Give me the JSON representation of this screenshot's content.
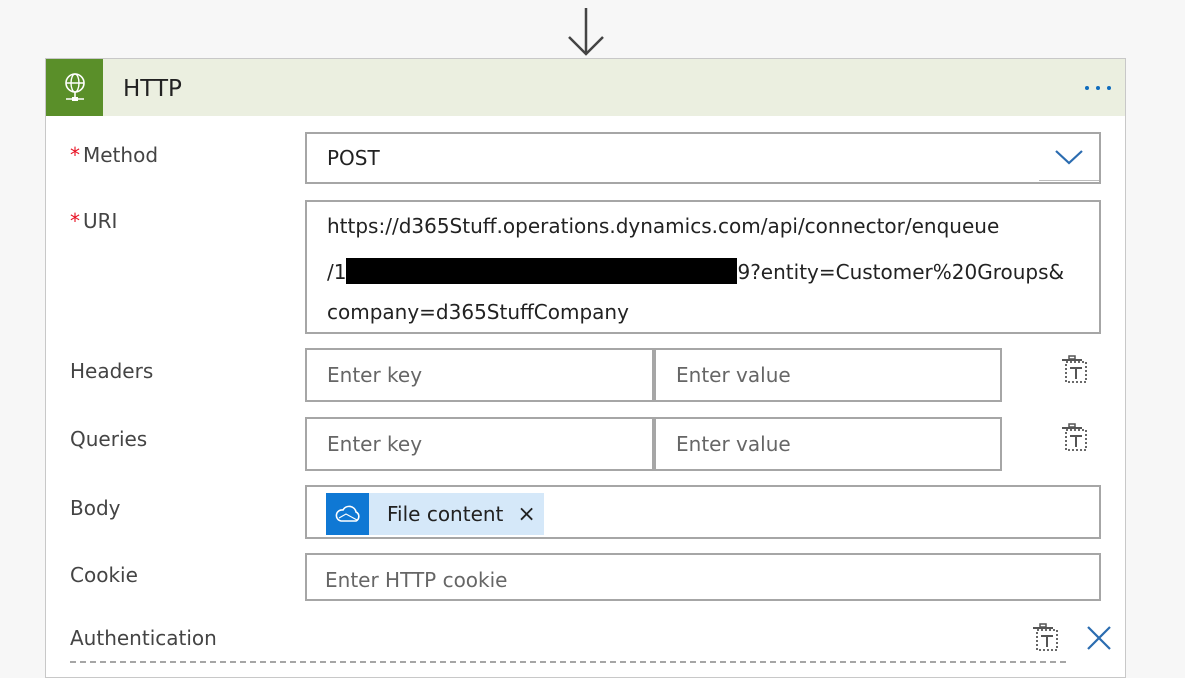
{
  "step": {
    "title": "HTTP",
    "more_glyph": "⋯"
  },
  "icons": {
    "header": "globe-network-icon",
    "arrow": "arrow-down-icon",
    "more": "more-horizontal-icon",
    "chevron": "chevron-down-icon",
    "delete": "trash-icon",
    "token": "onedrive-cloud-icon",
    "close": "close-icon"
  },
  "colors": {
    "header_bg": "#ebefe0",
    "header_icon_bg": "#5a8f29",
    "token_bg": "#d5e8f9",
    "token_icon_bg": "#0f78d4",
    "required": "#e81123",
    "link_blue": "#0f6cbd"
  },
  "fields": {
    "method": {
      "required_mark": "*",
      "label": "Method",
      "value": "POST"
    },
    "uri": {
      "required_mark": "*",
      "label": "URI",
      "line1": "https://d365Stuff.operations.dynamics.com/api/connector/enqueue",
      "line2_prefix": "/1",
      "line2_suffix": "9?entity=Customer%20Groups&",
      "line3": "company=d365StuffCompany"
    },
    "headers": {
      "label": "Headers",
      "key_placeholder": "Enter key",
      "value_placeholder": "Enter value"
    },
    "queries": {
      "label": "Queries",
      "key_placeholder": "Enter key",
      "value_placeholder": "Enter value"
    },
    "body": {
      "label": "Body",
      "token_label": "File content",
      "token_remove": "×"
    },
    "cookie": {
      "label": "Cookie",
      "placeholder": "Enter HTTP cookie"
    },
    "authentication": {
      "label": "Authentication"
    }
  }
}
